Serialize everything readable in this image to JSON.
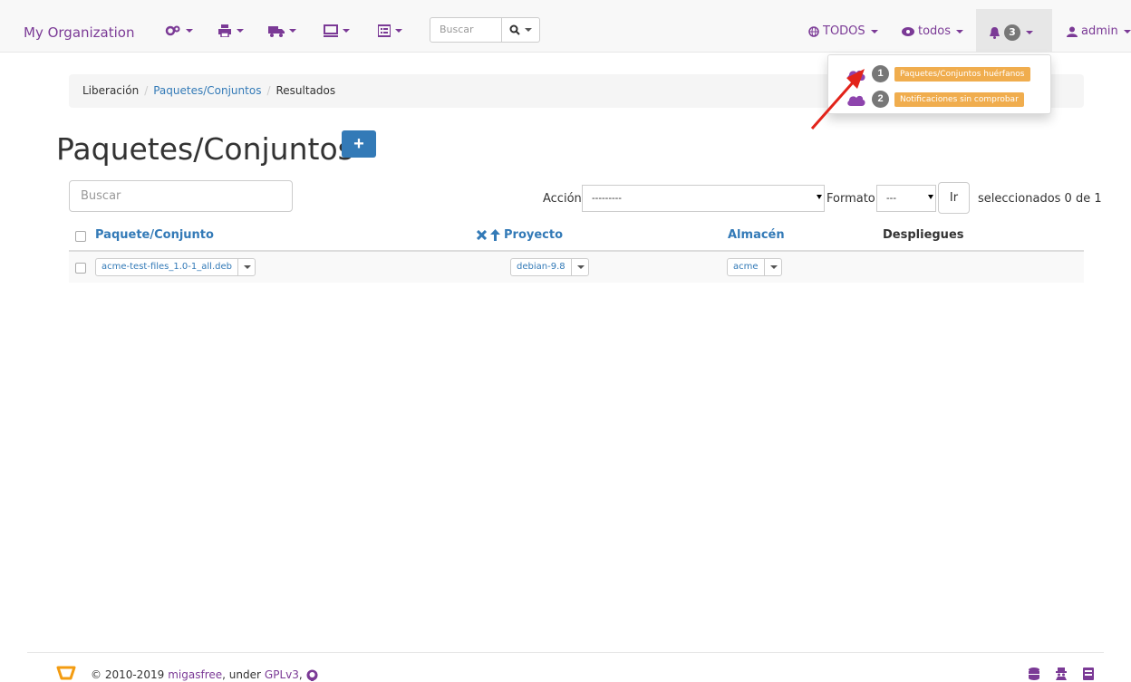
{
  "navbar": {
    "brand": "My Organization",
    "search_placeholder": "Buscar",
    "icons": [
      "settings-icon",
      "print-icon",
      "truck-icon",
      "laptop-icon",
      "list-icon"
    ],
    "scope_label": "TODOS",
    "view_label": "todos",
    "notifications_count": "3",
    "user_label": "admin"
  },
  "breadcrumb": {
    "items": [
      "Liberación",
      "Paquetes/Conjuntos",
      "Resultados"
    ]
  },
  "notifications": {
    "items": [
      {
        "count": "1",
        "label": "Paquetes/Conjuntos huérfanos"
      },
      {
        "count": "2",
        "label": "Notificaciones sin comprobar"
      }
    ]
  },
  "page": {
    "title": "Paquetes/Conjuntos",
    "add_label": "+"
  },
  "filters": {
    "search_placeholder": "Buscar",
    "action_label": "Acción:",
    "action_value": "---------",
    "format_label": "Formato",
    "format_value": "---",
    "go_label": "Ir",
    "selected_text": "seleccionados 0 de 1"
  },
  "table": {
    "columns": [
      "Paquete/Conjunto",
      "Proyecto",
      "Almacén",
      "Despliegues"
    ],
    "rows": [
      {
        "package": "acme-test-files_1.0-1_all.deb",
        "project": "debian-9.8",
        "store": "acme",
        "deployments": ""
      }
    ]
  },
  "footer": {
    "copyright": "© 2010-2019",
    "project_link": "migasfree",
    "under": ", under",
    "license_link": "GPLv3",
    "comma": ","
  },
  "colors": {
    "brand": "#7b3a96",
    "link": "#337ab7",
    "warning": "#f0ad4e",
    "arrow": "#e2231a"
  }
}
